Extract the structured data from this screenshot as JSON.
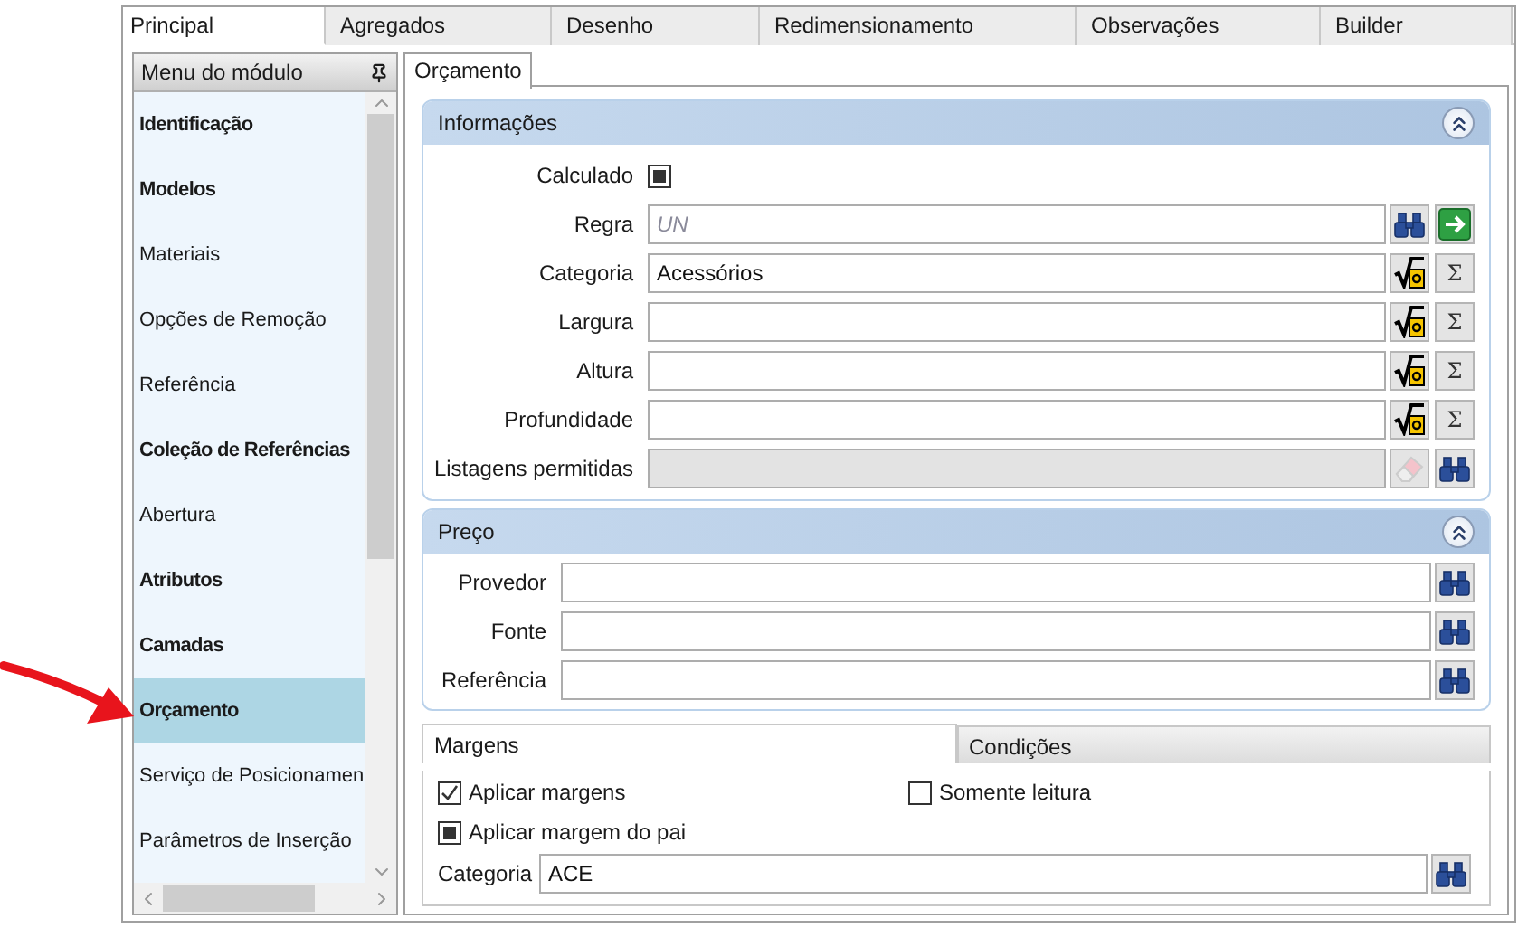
{
  "tabs": [
    {
      "label": "Principal",
      "selected": true
    },
    {
      "label": "Agregados",
      "selected": false
    },
    {
      "label": "Desenho",
      "selected": false
    },
    {
      "label": "Redimensionamento",
      "selected": false
    },
    {
      "label": "Observações",
      "selected": false
    },
    {
      "label": "Builder",
      "selected": false
    }
  ],
  "sidebar": {
    "title": "Menu do módulo",
    "items": [
      {
        "label": "Identificação",
        "bold": true,
        "selected": false
      },
      {
        "label": "Modelos",
        "bold": true,
        "selected": false
      },
      {
        "label": "Materiais",
        "bold": false,
        "selected": false
      },
      {
        "label": "Opções de Remoção",
        "bold": false,
        "selected": false
      },
      {
        "label": "Referência",
        "bold": false,
        "selected": false
      },
      {
        "label": "Coleção de Referências",
        "bold": true,
        "selected": false
      },
      {
        "label": "Abertura",
        "bold": false,
        "selected": false
      },
      {
        "label": "Atributos",
        "bold": true,
        "selected": false
      },
      {
        "label": "Camadas",
        "bold": true,
        "selected": false
      },
      {
        "label": "Orçamento",
        "bold": true,
        "selected": true
      },
      {
        "label": "Serviço de Posicionamen",
        "bold": false,
        "selected": false
      },
      {
        "label": "Parâmetros de Inserção",
        "bold": false,
        "selected": false
      }
    ]
  },
  "subtabs": [
    {
      "label": "Orçamento",
      "selected": true
    }
  ],
  "informacoes": {
    "title": "Informações",
    "expanded": true,
    "rows": [
      {
        "kind": "checkbox",
        "label": "Calculado",
        "checked": false,
        "indeterminate": true
      },
      {
        "kind": "field",
        "label": "Regra",
        "placeholder": "UN",
        "disabled": false,
        "actions": [
          {
            "kind": "search"
          },
          {
            "kind": "apply"
          }
        ]
      },
      {
        "kind": "field",
        "label": "Categoria",
        "value": "Acessórios",
        "disabled": false,
        "actions": [
          {
            "kind": "formula"
          },
          {
            "kind": "sum",
            "label": "Σ"
          }
        ]
      },
      {
        "kind": "field",
        "label": "Largura",
        "disabled": false,
        "actions": [
          {
            "kind": "formula"
          },
          {
            "kind": "sum",
            "label": "Σ"
          }
        ]
      },
      {
        "kind": "field",
        "label": "Altura",
        "disabled": false,
        "actions": [
          {
            "kind": "formula"
          },
          {
            "kind": "sum",
            "label": "Σ"
          }
        ]
      },
      {
        "kind": "field",
        "label": "Profundidade",
        "disabled": false,
        "actions": [
          {
            "kind": "formula"
          },
          {
            "kind": "sum",
            "label": "Σ"
          }
        ]
      },
      {
        "kind": "field",
        "label": "Listagens permitidas",
        "disabled": true,
        "actions": [
          {
            "kind": "clear"
          },
          {
            "kind": "search"
          }
        ]
      }
    ]
  },
  "preco": {
    "title": "Preço",
    "expanded": true,
    "rows": [
      {
        "kind": "field",
        "label": "Provedor",
        "disabled": false,
        "actions": [
          {
            "kind": "search"
          }
        ]
      },
      {
        "kind": "field",
        "label": "Fonte",
        "disabled": false,
        "actions": [
          {
            "kind": "search"
          }
        ]
      },
      {
        "kind": "field",
        "label": "Referência",
        "disabled": false,
        "actions": [
          {
            "kind": "search"
          }
        ]
      }
    ]
  },
  "margens": {
    "tabs": [
      {
        "label": "Margens",
        "selected": true
      },
      {
        "label": "Condições",
        "selected": false
      }
    ],
    "checkboxes": [
      {
        "label": "Aplicar margens",
        "checked": true,
        "indeterminate": false
      },
      {
        "label": "Somente leitura",
        "checked": false,
        "indeterminate": false
      },
      {
        "label": "Aplicar margem do pai",
        "checked": false,
        "indeterminate": true
      }
    ],
    "field": {
      "label": "Categoria",
      "value": "ACE",
      "actions": [
        {
          "kind": "search"
        }
      ]
    }
  }
}
